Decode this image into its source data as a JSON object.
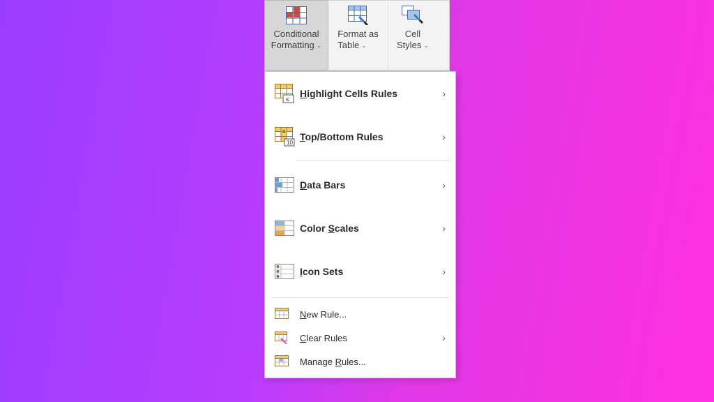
{
  "ribbon": {
    "conditional_l1": "Conditional",
    "conditional_l2": "Formatting",
    "format_l1": "Format as",
    "format_l2": "Table",
    "cell_l1": "Cell",
    "cell_l2": "Styles"
  },
  "menu": {
    "highlight_pre": "H",
    "highlight_post": "ighlight Cells Rules",
    "topbottom_pre": "T",
    "topbottom_post": "op/Bottom Rules",
    "databars_pre": "D",
    "databars_post": "ata Bars",
    "colorscales_pre": "Color ",
    "colorscales_u": "S",
    "colorscales_post": "cales",
    "iconsets_pre": "I",
    "iconsets_post": "con Sets",
    "newrule_pre": "N",
    "newrule_post": "ew Rule...",
    "clear_pre": "C",
    "clear_post": "lear Rules",
    "manage_pre": "Manage ",
    "manage_u": "R",
    "manage_post": "ules..."
  }
}
